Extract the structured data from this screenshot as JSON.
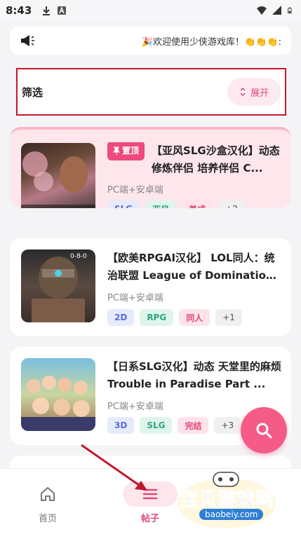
{
  "status_bar": {
    "time": "8:43",
    "icons_left": [
      "download-icon",
      "translate-icon"
    ],
    "icons_right": [
      "wifi-icon",
      "signal-icon",
      "battery-icon"
    ]
  },
  "announcement": {
    "text": "🎉欢迎使用少侠游戏库！👏👏👏:"
  },
  "filter": {
    "label": "筛选",
    "expand_label": "展开"
  },
  "posts": [
    {
      "pinned": true,
      "pin_label": "置顶",
      "title": "【亚风SLG沙盒汉化】动态 修炼伴侣 培养伴侣 C...",
      "platform": "PC端+安卓端",
      "tags": [
        "SLG",
        "亚风",
        "养成"
      ],
      "more": "+2"
    },
    {
      "pinned": false,
      "title": "【欧美RPGAI汉化】 LOL同人：统治联盟 League of Domination ...",
      "platform": "PC端+安卓端",
      "tags": [
        "2D",
        "RPG",
        "同人"
      ],
      "more": "+1",
      "thumb_caption": "0-8-0"
    },
    {
      "pinned": false,
      "title": "【日系SLG汉化】动态 天堂里的麻烦 Trouble in Paradise Part ...",
      "platform": "PC端+安卓端",
      "tags": [
        "3D",
        "SLG",
        "完结"
      ],
      "more": "+3"
    }
  ],
  "bottom_nav": {
    "home_label": "首页",
    "posts_label": "帖子",
    "active": "posts"
  },
  "watermark": {
    "text": "宝贝游戏网",
    "url": "baobeiy.com"
  },
  "colors": {
    "accent": "#ee4a7c",
    "annotation_red": "#c0182c"
  }
}
